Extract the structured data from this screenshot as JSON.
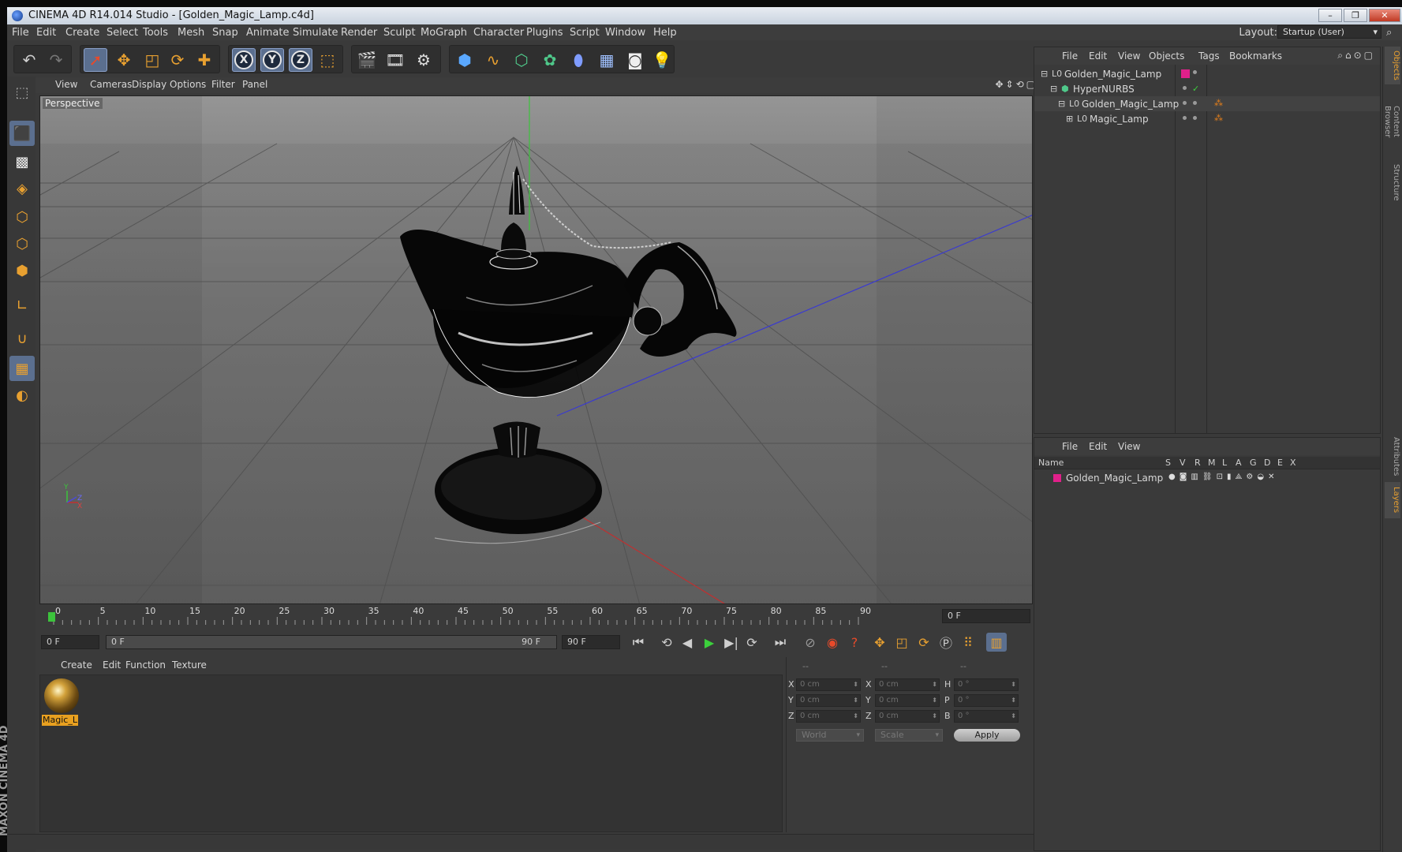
{
  "window": {
    "title": "CINEMA 4D R14.014 Studio - [Golden_Magic_Lamp.c4d]",
    "buttons": [
      "–",
      "❐",
      "✕"
    ]
  },
  "menubar": {
    "items": [
      "File",
      "Edit",
      "Create",
      "Select",
      "Tools",
      "Mesh",
      "Snap",
      "Animate",
      "Simulate",
      "Render",
      "Sculpt",
      "MoGraph",
      "Character",
      "Plugins",
      "Script",
      "Window",
      "Help"
    ],
    "layout_label": "Layout:",
    "layout_value": "Startup (User)"
  },
  "toolbar": {
    "axis_x": "X",
    "axis_y": "Y",
    "axis_z": "Z"
  },
  "viewport": {
    "menu": [
      "View",
      "Cameras",
      "Display",
      "Options",
      "Filter",
      "Panel"
    ],
    "label": "Perspective",
    "gizmo_y": "Y",
    "gizmo_z": "Z",
    "gizmo_x": "X"
  },
  "timeline": {
    "ticks": [
      "0",
      "5",
      "10",
      "15",
      "20",
      "25",
      "30",
      "35",
      "40",
      "45",
      "50",
      "55",
      "60",
      "65",
      "70",
      "75",
      "80",
      "85",
      "90"
    ],
    "current_frame": "0 F",
    "start_field": "0 F",
    "range_start": "0 F",
    "range_end": "90 F",
    "end_field": "90 F"
  },
  "material_manager": {
    "menu": [
      "Create",
      "Edit",
      "Function",
      "Texture"
    ],
    "material_label": "Magic_L"
  },
  "coordinates": {
    "headers": [
      "--",
      "--",
      "--"
    ],
    "rows": [
      {
        "l1": "X",
        "v1": "0 cm",
        "l2": "X",
        "v2": "0 cm",
        "l3": "H",
        "v3": "0 °"
      },
      {
        "l1": "Y",
        "v1": "0 cm",
        "l2": "Y",
        "v2": "0 cm",
        "l3": "P",
        "v3": "0 °"
      },
      {
        "l1": "Z",
        "v1": "0 cm",
        "l2": "Z",
        "v2": "0 cm",
        "l3": "B",
        "v3": "0 °"
      }
    ],
    "mode_select": "World",
    "scale_select": "Scale",
    "apply": "Apply"
  },
  "object_manager": {
    "menu": [
      "File",
      "Edit",
      "View",
      "Objects",
      "Tags",
      "Bookmarks"
    ],
    "objects": [
      {
        "name": "Golden_Magic_Lamp",
        "icon": "L0"
      },
      {
        "name": "HyperNURBS",
        "icon": "⬢"
      },
      {
        "name": "Golden_Magic_Lamp",
        "icon": "L0"
      },
      {
        "name": "Magic_Lamp",
        "icon": "L0"
      }
    ]
  },
  "layer_manager": {
    "menu": [
      "File",
      "Edit",
      "View"
    ],
    "columns": [
      "Name",
      "S",
      "V",
      "R",
      "M",
      "L",
      "A",
      "G",
      "D",
      "E",
      "X"
    ],
    "layers": [
      {
        "name": "Golden_Magic_Lamp",
        "color": "#e0208a"
      }
    ]
  },
  "side_tabs": [
    "Objects",
    "Content Browser",
    "Structure",
    "Attributes",
    "Layers"
  ],
  "colors": {
    "accent": "#e8a030",
    "layer_color": "#e0208a",
    "active_tool": "#5b6f8f"
  }
}
